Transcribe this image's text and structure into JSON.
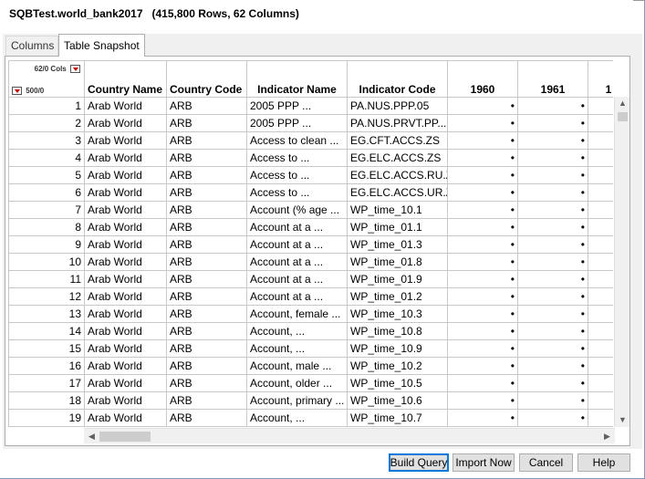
{
  "window": {
    "title": "SQBTest.world_bank2017   (415,800 Rows, 62 Columns)"
  },
  "tabs": [
    {
      "label": "Columns"
    },
    {
      "label": "Table Snapshot"
    }
  ],
  "table": {
    "corner": {
      "cols_label": "62/0 Cols",
      "rows_label": "500/0"
    },
    "headers": [
      "Country Name",
      "Country Code",
      "Indicator Name",
      "Indicator Code",
      "1960",
      "1961",
      "1"
    ],
    "missing_marker": "•",
    "rows": [
      {
        "n": "1",
        "name": "Arab World",
        "code": "ARB",
        "ind_name": "2005 PPP ...",
        "ind_code": "PA.NUS.PPP.05"
      },
      {
        "n": "2",
        "name": "Arab World",
        "code": "ARB",
        "ind_name": "2005 PPP ...",
        "ind_code": "PA.NUS.PRVT.PP...."
      },
      {
        "n": "3",
        "name": "Arab World",
        "code": "ARB",
        "ind_name": "Access to clean ...",
        "ind_code": "EG.CFT.ACCS.ZS"
      },
      {
        "n": "4",
        "name": "Arab World",
        "code": "ARB",
        "ind_name": "Access to ...",
        "ind_code": "EG.ELC.ACCS.ZS"
      },
      {
        "n": "5",
        "name": "Arab World",
        "code": "ARB",
        "ind_name": "Access to ...",
        "ind_code": "EG.ELC.ACCS.RU.ZS"
      },
      {
        "n": "6",
        "name": "Arab World",
        "code": "ARB",
        "ind_name": "Access to ...",
        "ind_code": "EG.ELC.ACCS.UR.ZS"
      },
      {
        "n": "7",
        "name": "Arab World",
        "code": "ARB",
        "ind_name": "Account (% age ...",
        "ind_code": "WP_time_10.1"
      },
      {
        "n": "8",
        "name": "Arab World",
        "code": "ARB",
        "ind_name": "Account at a ...",
        "ind_code": "WP_time_01.1"
      },
      {
        "n": "9",
        "name": "Arab World",
        "code": "ARB",
        "ind_name": "Account at a ...",
        "ind_code": "WP_time_01.3"
      },
      {
        "n": "10",
        "name": "Arab World",
        "code": "ARB",
        "ind_name": "Account at a ...",
        "ind_code": "WP_time_01.8"
      },
      {
        "n": "11",
        "name": "Arab World",
        "code": "ARB",
        "ind_name": "Account at a ...",
        "ind_code": "WP_time_01.9"
      },
      {
        "n": "12",
        "name": "Arab World",
        "code": "ARB",
        "ind_name": "Account at a ...",
        "ind_code": "WP_time_01.2"
      },
      {
        "n": "13",
        "name": "Arab World",
        "code": "ARB",
        "ind_name": "Account, female ...",
        "ind_code": "WP_time_10.3"
      },
      {
        "n": "14",
        "name": "Arab World",
        "code": "ARB",
        "ind_name": "Account, ...",
        "ind_code": "WP_time_10.8"
      },
      {
        "n": "15",
        "name": "Arab World",
        "code": "ARB",
        "ind_name": "Account, ...",
        "ind_code": "WP_time_10.9"
      },
      {
        "n": "16",
        "name": "Arab World",
        "code": "ARB",
        "ind_name": "Account, male ...",
        "ind_code": "WP_time_10.2"
      },
      {
        "n": "17",
        "name": "Arab World",
        "code": "ARB",
        "ind_name": "Account, older ...",
        "ind_code": "WP_time_10.5"
      },
      {
        "n": "18",
        "name": "Arab World",
        "code": "ARB",
        "ind_name": "Account, primary ...",
        "ind_code": "WP_time_10.6"
      },
      {
        "n": "19",
        "name": "Arab World",
        "code": "ARB",
        "ind_name": "Account, ...",
        "ind_code": "WP_time_10.7"
      }
    ]
  },
  "buttons": {
    "build_query": "Build Query",
    "import_now": "Import Now",
    "cancel": "Cancel",
    "help": "Help"
  },
  "icons": {
    "dropdown": "red-triangle-dropdown-icon",
    "scroll_up": "chevron-up-icon",
    "scroll_down": "chevron-down-icon",
    "scroll_left": "chevron-left-icon",
    "scroll_right": "chevron-right-icon"
  },
  "colors": {
    "accent": "#0078d7",
    "dropdown_triangle": "#c00000"
  }
}
